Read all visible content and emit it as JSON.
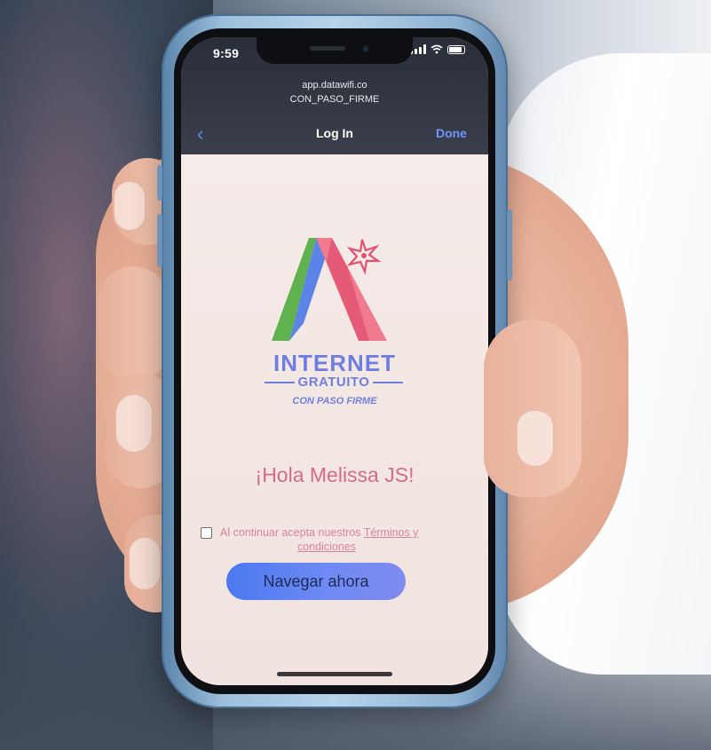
{
  "status_bar": {
    "time": "9:59"
  },
  "browser": {
    "url": "app.datawifi.co",
    "network": "CON_PASO_FIRME"
  },
  "nav": {
    "back_icon": "‹",
    "title": "Log In",
    "done_label": "Done"
  },
  "brand": {
    "line1": "INTERNET",
    "line2": "GRATUITO",
    "line3": "CON PASO FIRME",
    "colors": {
      "green": "#5fb24e",
      "blue": "#5b84e6",
      "pink": "#f07a8e",
      "red": "#e2506e",
      "text": "#6f7fe0"
    }
  },
  "greeting": "¡Hola Melissa JS!",
  "terms": {
    "prefix": "Al continuar acepta nuestros",
    "link_part1": "Términos y",
    "link_part2": "condiciones",
    "checked": false
  },
  "cta_label": "Navegar ahora"
}
